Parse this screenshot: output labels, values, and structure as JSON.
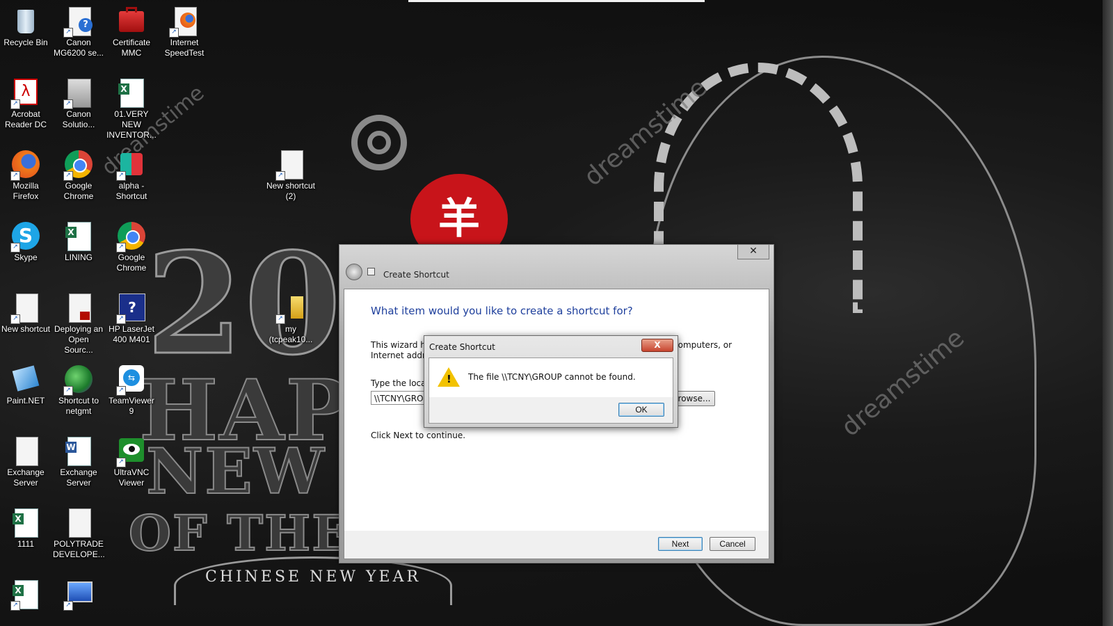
{
  "desktop": {
    "background_texts": {
      "year": "201",
      "happy": "HAP",
      "new_year": "NEW Y",
      "of_the": "OF THE G",
      "ribbon": "CHINESE NEW YEAR",
      "seal": "羊",
      "watermark": "dreamstime"
    },
    "icons": [
      {
        "label": "Recycle Bin",
        "icon": "recycle-bin-icon"
      },
      {
        "label": "Canon MG6200 se...",
        "icon": "canon-printer-help-icon"
      },
      {
        "label": "Certificate MMC",
        "icon": "toolbox-icon"
      },
      {
        "label": "Internet SpeedTest",
        "icon": "firefox-document-icon"
      },
      {
        "label": "Acrobat Reader DC",
        "icon": "acrobat-icon"
      },
      {
        "label": "Canon Solutio...",
        "icon": "canon-solution-icon"
      },
      {
        "label": "01.VERY NEW INVENTOR...",
        "icon": "excel-icon"
      },
      {
        "label": "Mozilla Firefox",
        "icon": "firefox-icon"
      },
      {
        "label": "Google Chrome",
        "icon": "chrome-icon"
      },
      {
        "label": "alpha - Shortcut",
        "icon": "alpha-shirt-icon"
      },
      {
        "label": "New shortcut (2)",
        "icon": "blank-document-icon"
      },
      {
        "label": "Skype",
        "icon": "skype-icon"
      },
      {
        "label": "LINING",
        "icon": "excel-icon"
      },
      {
        "label": "Google Chrome",
        "icon": "chrome-icon"
      },
      {
        "label": "New shortcut",
        "icon": "blank-document-icon"
      },
      {
        "label": "Deploying an Open Sourc...",
        "icon": "pdf-document-icon"
      },
      {
        "label": "HP LaserJet 400 M401",
        "icon": "hp-help-icon"
      },
      {
        "label": "my (tcpeak10...",
        "icon": "folder-icon"
      },
      {
        "label": "Paint.NET",
        "icon": "paint-net-icon"
      },
      {
        "label": "Shortcut to netgmt",
        "icon": "network-globe-icon"
      },
      {
        "label": "TeamViewer 9",
        "icon": "teamviewer-icon"
      },
      {
        "label": "Exchange Server",
        "icon": "blank-document-icon"
      },
      {
        "label": "Exchange Server",
        "icon": "word-icon"
      },
      {
        "label": "UltraVNC Viewer",
        "icon": "ultravnc-eye-icon"
      },
      {
        "label": "1111",
        "icon": "excel-icon"
      },
      {
        "label": "POLYTRADE DEVELOPE...",
        "icon": "blank-document-icon"
      },
      {
        "label": "",
        "icon": "excel-icon"
      },
      {
        "label": "",
        "icon": "computer-network-icon"
      }
    ]
  },
  "wizard": {
    "title": "Create Shortcut",
    "close_label": "✕",
    "heading": "What item would you like to create a shortcut for?",
    "description_start": "This wizard he",
    "description_start_line2": "Internet addre",
    "description_end": "computers, or",
    "location_label": "Type the locati",
    "location_value": "\\\\TCNY\\GROU",
    "browse_label": "rowse...",
    "next_hint": "Click Next to continue.",
    "next_label": "Next",
    "cancel_label": "Cancel"
  },
  "alert": {
    "title": "Create Shortcut",
    "close_label": "X",
    "message": "The file \\\\TCNY\\GROUP cannot be found.",
    "ok_label": "OK",
    "warning_mark": "!"
  },
  "colors": {
    "heading_blue": "#1e3f9c",
    "seal_red": "#c8141a",
    "warning_yellow": "#f2c200"
  }
}
